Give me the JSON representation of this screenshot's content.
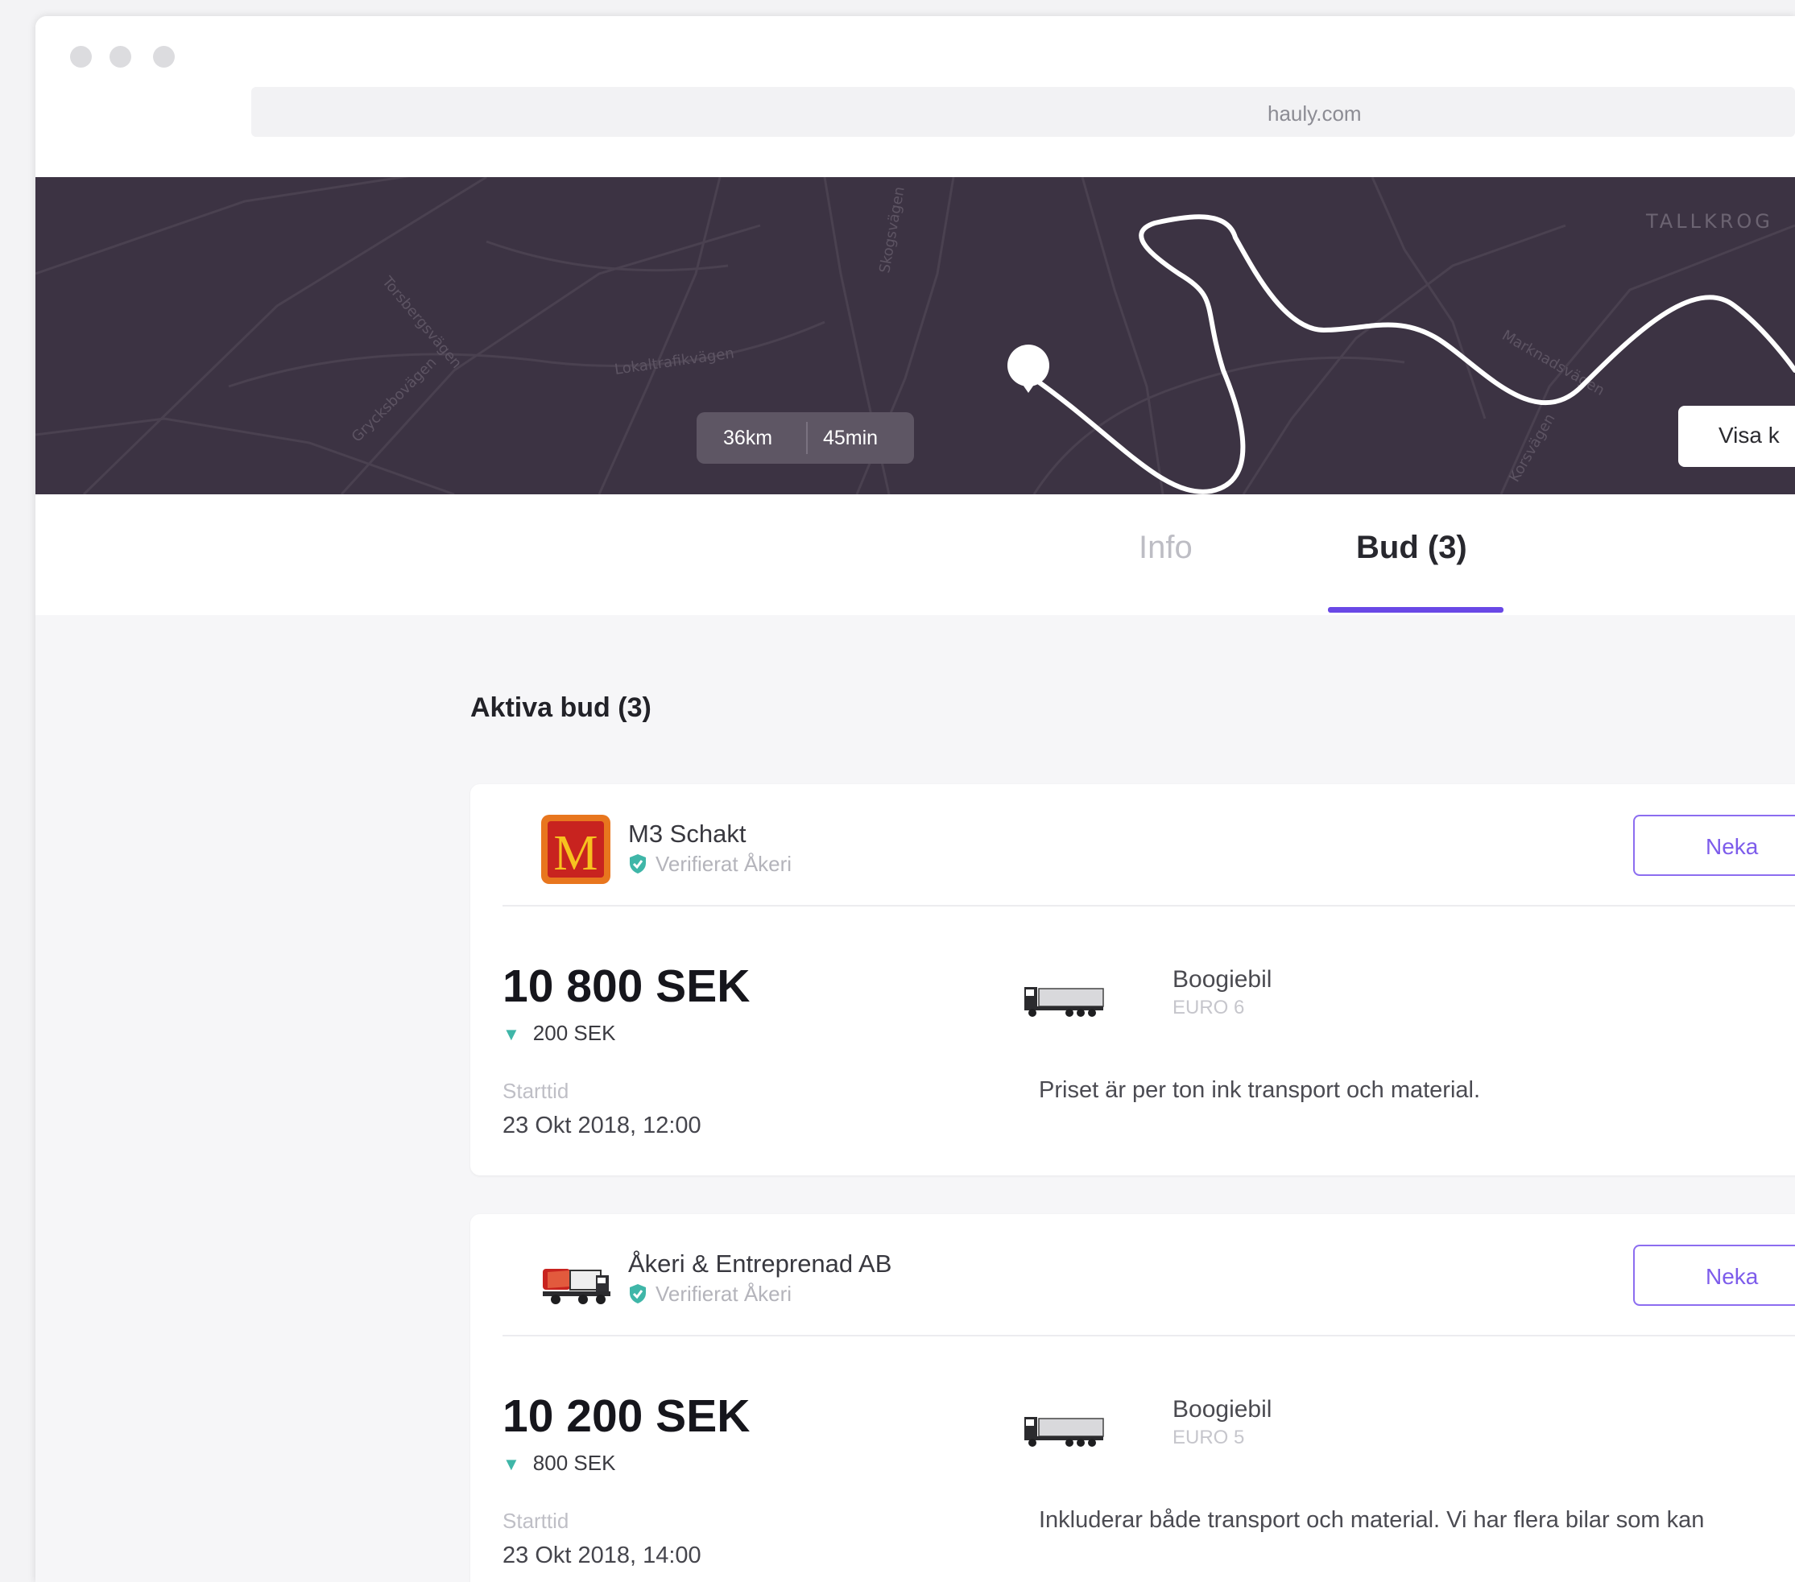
{
  "browser": {
    "url": "hauly.com"
  },
  "map": {
    "distance": "36km",
    "duration": "45min",
    "area_label": "TALLKROG",
    "show_button_label": "Visa k",
    "colors": {
      "background": "#3c3343",
      "route": "#ffffff"
    }
  },
  "tabs": [
    {
      "label": "Info",
      "active": false
    },
    {
      "label": "Bud (3)",
      "active": true
    }
  ],
  "section": {
    "title": "Aktiva bud (3)"
  },
  "bids": [
    {
      "company": "M3 Schakt",
      "logo_letter": "M",
      "verified_label": "Verifierat Åkeri",
      "reject_label": "Neka",
      "price": "10 800 SEK",
      "price_drop": "200 SEK",
      "start_label": "Starttid",
      "start_time": "23 Okt 2018, 12:00",
      "vehicle": "Boogiebil",
      "euro_class": "EURO 6",
      "note": "Priset är per ton ink transport och material."
    },
    {
      "company": "Åkeri & Entreprenad AB",
      "verified_label": "Verifierat Åkeri",
      "reject_label": "Neka",
      "price": "10 200 SEK",
      "price_drop": "800 SEK",
      "start_label": "Starttid",
      "start_time": "23 Okt 2018, 14:00",
      "vehicle": "Boogiebil",
      "euro_class": "EURO 5",
      "note": "Inkluderar både transport och material. Vi har flera bilar som kan"
    }
  ],
  "icons": {
    "window_controls": "traffic-light-dots",
    "verified": "shield-check-icon",
    "price_drop": "triangle-down-icon",
    "vehicle": "truck-icon",
    "map_pin": "map-pin-icon"
  },
  "colors": {
    "accent": "#6948e6",
    "verified": "#3fb6a8",
    "page_bg": "#f6f6f8"
  }
}
